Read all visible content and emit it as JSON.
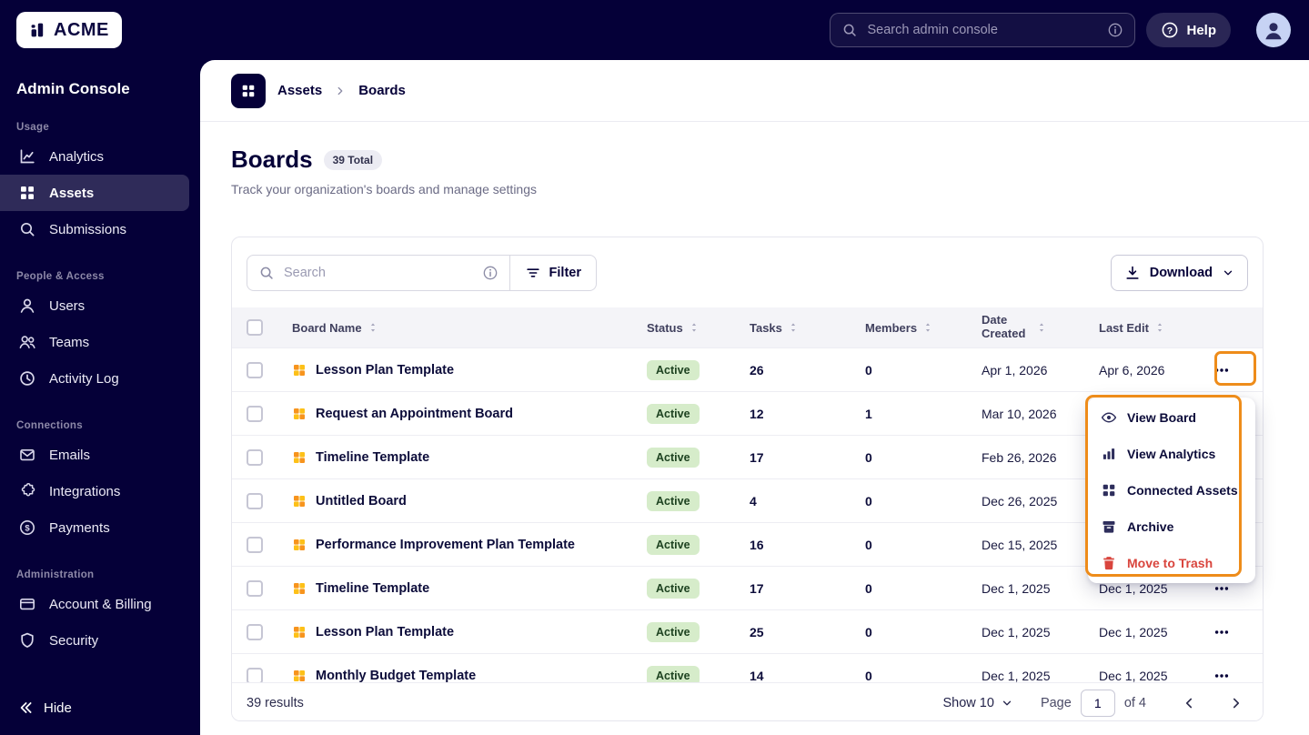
{
  "topbar": {
    "logo_text": "ACME",
    "search_placeholder": "Search admin console",
    "help_label": "Help"
  },
  "sidebar": {
    "title": "Admin Console",
    "hide_label": "Hide",
    "sections": [
      {
        "label": "Usage",
        "items": [
          {
            "label": "Analytics",
            "icon": "analytics-icon",
            "selected": false
          },
          {
            "label": "Assets",
            "icon": "assets-grid-icon",
            "selected": true
          },
          {
            "label": "Submissions",
            "icon": "submissions-search-icon",
            "selected": false
          }
        ]
      },
      {
        "label": "People & Access",
        "items": [
          {
            "label": "Users",
            "icon": "user-icon",
            "selected": false
          },
          {
            "label": "Teams",
            "icon": "teams-icon",
            "selected": false
          },
          {
            "label": "Activity Log",
            "icon": "activity-clock-icon",
            "selected": false
          }
        ]
      },
      {
        "label": "Connections",
        "items": [
          {
            "label": "Emails",
            "icon": "envelope-icon",
            "selected": false
          },
          {
            "label": "Integrations",
            "icon": "puzzle-icon",
            "selected": false
          },
          {
            "label": "Payments",
            "icon": "payments-coin-icon",
            "selected": false
          }
        ]
      },
      {
        "label": "Administration",
        "items": [
          {
            "label": "Account & Billing",
            "icon": "billing-card-icon",
            "selected": false
          },
          {
            "label": "Security",
            "icon": "shield-icon",
            "selected": false
          }
        ]
      }
    ]
  },
  "breadcrumb": {
    "parent": "Assets",
    "current": "Boards"
  },
  "page": {
    "title": "Boards",
    "total_badge": "39 Total",
    "subtitle": "Track your organization's boards and manage settings"
  },
  "toolbar": {
    "search_placeholder": "Search",
    "filter_label": "Filter",
    "download_label": "Download"
  },
  "table": {
    "headers": {
      "name": "Board Name",
      "status": "Status",
      "tasks": "Tasks",
      "members": "Members",
      "date_created": "Date Created",
      "last_edit": "Last Edit"
    },
    "rows": [
      {
        "name": "Lesson Plan Template",
        "status": "Active",
        "tasks": "26",
        "members": "0",
        "date_created": "Apr 1, 2026",
        "last_edit": "Apr 6, 2026"
      },
      {
        "name": "Request an Appointment Board",
        "status": "Active",
        "tasks": "12",
        "members": "1",
        "date_created": "Mar 10, 2026",
        "last_edit": ""
      },
      {
        "name": "Timeline Template",
        "status": "Active",
        "tasks": "17",
        "members": "0",
        "date_created": "Feb 26, 2026",
        "last_edit": ""
      },
      {
        "name": "Untitled Board",
        "status": "Active",
        "tasks": "4",
        "members": "0",
        "date_created": "Dec 26, 2025",
        "last_edit": ""
      },
      {
        "name": "Performance Improvement Plan Template",
        "status": "Active",
        "tasks": "16",
        "members": "0",
        "date_created": "Dec 15, 2025",
        "last_edit": ""
      },
      {
        "name": "Timeline Template",
        "status": "Active",
        "tasks": "17",
        "members": "0",
        "date_created": "Dec 1, 2025",
        "last_edit": "Dec 1, 2025"
      },
      {
        "name": "Lesson Plan Template",
        "status": "Active",
        "tasks": "25",
        "members": "0",
        "date_created": "Dec 1, 2025",
        "last_edit": "Dec 1, 2025"
      },
      {
        "name": "Monthly Budget Template",
        "status": "Active",
        "tasks": "14",
        "members": "0",
        "date_created": "Dec 1, 2025",
        "last_edit": "Dec 1, 2025"
      }
    ]
  },
  "context_menu": {
    "items": [
      {
        "label": "View Board",
        "icon": "eye-icon",
        "danger": false
      },
      {
        "label": "View Analytics",
        "icon": "bar-chart-icon",
        "danger": false
      },
      {
        "label": "Connected Assets",
        "icon": "connected-assets-icon",
        "danger": false
      },
      {
        "label": "Archive",
        "icon": "archive-icon",
        "danger": false
      },
      {
        "label": "Move to Trash",
        "icon": "trash-icon",
        "danger": true
      }
    ]
  },
  "footer": {
    "results": "39 results",
    "show_label": "Show 10",
    "page_label": "Page",
    "page_value": "1",
    "of_label": "of 4"
  },
  "colors": {
    "brand_navy": "#050038",
    "annotation_orange": "#ee8c1a",
    "active_badge_bg": "#d6ecca",
    "active_badge_text": "#1d4220",
    "danger_red": "#d9453d"
  }
}
